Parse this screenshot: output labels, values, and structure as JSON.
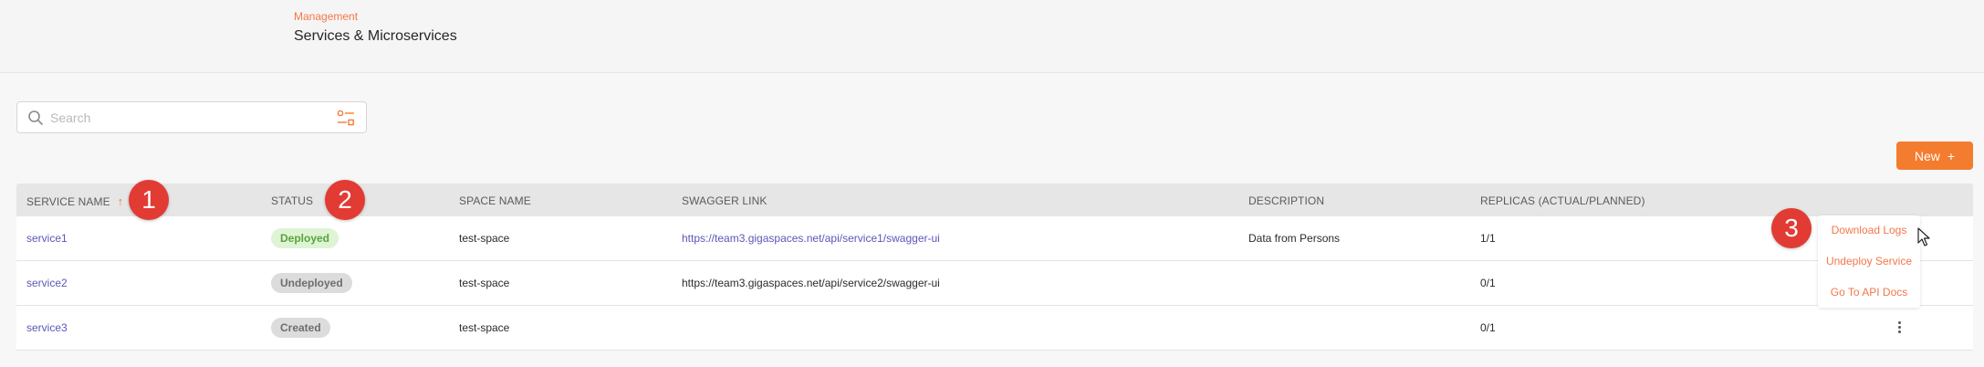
{
  "header": {
    "breadcrumb": "Management",
    "title": "Services & Microservices"
  },
  "search": {
    "placeholder": "Search",
    "value": ""
  },
  "actions": {
    "new_label": "New",
    "new_icon": "+"
  },
  "table": {
    "columns": [
      "SERVICE NAME",
      "STATUS",
      "SPACE NAME",
      "SWAGGER LINK",
      "DESCRIPTION",
      "REPLICAS (ACTUAL/PLANNED)"
    ],
    "sort_indicator": "↑",
    "rows": [
      {
        "service_name": "service1",
        "status": "Deployed",
        "space_name": "test-space",
        "swagger_link": "https://team3.gigaspaces.net/api/service1/swagger-ui",
        "description": "Data from Persons",
        "replicas": "1/1"
      },
      {
        "service_name": "service2",
        "status": "Undeployed",
        "space_name": "test-space",
        "swagger_link": "https://team3.gigaspaces.net/api/service2/swagger-ui",
        "description": "",
        "replicas": "0/1"
      },
      {
        "service_name": "service3",
        "status": "Created",
        "space_name": "test-space",
        "swagger_link": "",
        "description": "",
        "replicas": "0/1"
      }
    ]
  },
  "row_menu": {
    "items": [
      "Download Logs",
      "Undeploy Service",
      "Go To API Docs"
    ]
  },
  "markers": [
    "1",
    "2",
    "3"
  ],
  "colors": {
    "accent": "#f47c2f",
    "link": "#5b57b8",
    "marker": "#e23b34",
    "deployed_bg": "#dff3d5",
    "deployed_text": "#57a53a"
  },
  "icons": [
    "search-icon",
    "filter-icon",
    "sort-ascending-icon",
    "kebab-menu-icon",
    "mouse-cursor-icon"
  ]
}
